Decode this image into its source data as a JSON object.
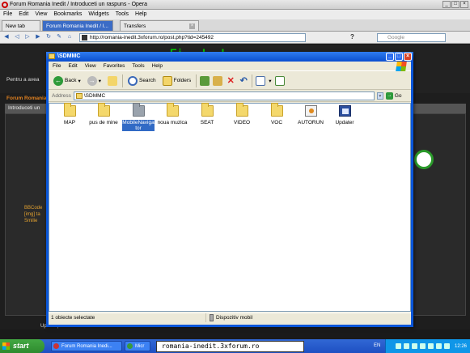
{
  "opera": {
    "title": "Forum Romania Inedit / Introduceti un raspuns - Opera",
    "menu": [
      "File",
      "Edit",
      "View",
      "Bookmarks",
      "Widgets",
      "Tools",
      "Help"
    ],
    "tabs": [
      {
        "label": "New tab"
      },
      {
        "label": "Forum Romania Inedit / I..."
      },
      {
        "label": "Transfers"
      }
    ],
    "address": "http://romania-inedit.3xforum.ro/post.php?tid=245492",
    "search_placeholder": "Google"
  },
  "forum": {
    "left_text": "Pentru a avea",
    "section_label": "Forum Romania",
    "bar_text": "Introduceti un",
    "side_lines": [
      "BBCode",
      "[img] ta",
      "Smilie"
    ],
    "footer_text": "Upload poze"
  },
  "explorer": {
    "title": "\\SDMMC",
    "menu": [
      "File",
      "Edit",
      "View",
      "Favorites",
      "Tools",
      "Help"
    ],
    "toolbar": {
      "back": "Back",
      "search": "Search",
      "folders": "Folders"
    },
    "address_label": "Address",
    "address_value": "\\SDMMC",
    "go_label": "Go",
    "items": [
      {
        "name": "MAP",
        "type": "folder"
      },
      {
        "name": "pus de mine",
        "type": "folder"
      },
      {
        "name": "MobileNavigator",
        "type": "folder-gray",
        "selected": true
      },
      {
        "name": "noua muzica",
        "type": "folder"
      },
      {
        "name": "SEAT",
        "type": "folder"
      },
      {
        "name": "VIDEO",
        "type": "folder"
      },
      {
        "name": "VOC",
        "type": "folder"
      },
      {
        "name": "AUTORUN",
        "type": "app"
      },
      {
        "name": "Updater",
        "type": "updater"
      }
    ],
    "status_left": "1 obiecte selectate",
    "status_right": "Dispozitiv mobil"
  },
  "taskbar": {
    "start": "start",
    "tasks": [
      {
        "label": "Forum Romania Inedi..."
      },
      {
        "label": "Micr"
      }
    ],
    "lang": "EN",
    "clock": "12:26",
    "tooltip": "romania-inedit.3xforum.ro"
  }
}
